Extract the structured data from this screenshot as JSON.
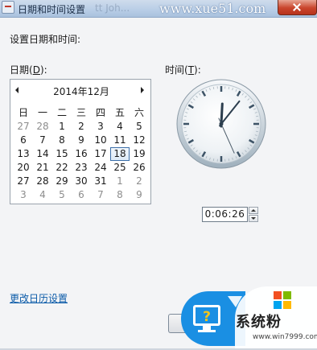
{
  "window": {
    "title": "日期和时间设置",
    "title_ghost": "tt Joh...",
    "watermark": "www.xue51.com"
  },
  "heading": "设置日期和时间:",
  "date_section": {
    "label_prefix": "日期(",
    "accel": "D",
    "label_suffix": "):"
  },
  "time_section": {
    "label_prefix": "时间(",
    "accel": "T",
    "label_suffix": "):"
  },
  "calendar": {
    "month_title": "2014年12月",
    "weekdays": [
      "日",
      "一",
      "二",
      "三",
      "四",
      "五",
      "六"
    ],
    "weeks": [
      [
        "27",
        "28",
        "1",
        "2",
        "3",
        "4",
        "5"
      ],
      [
        "6",
        "7",
        "8",
        "9",
        "10",
        "11",
        "12"
      ],
      [
        "13",
        "14",
        "15",
        "16",
        "17",
        "18",
        "19"
      ],
      [
        "20",
        "21",
        "22",
        "23",
        "24",
        "25",
        "26"
      ],
      [
        "27",
        "28",
        "29",
        "30",
        "31",
        "1",
        "2"
      ],
      [
        "3",
        "4",
        "5",
        "6",
        "7",
        "8",
        "9"
      ]
    ],
    "selected_day": "18"
  },
  "clock": {
    "hours": 0,
    "minutes": 6,
    "seconds": 26
  },
  "time_value": "0:06:26",
  "change_calendar_link": "更改日历设置",
  "logo": {
    "text": "系统粉",
    "url": "www.win7999.com"
  },
  "colors": {
    "link": "#0a5aa8",
    "accent_blue": "#1a8fe3",
    "titlebar": "#b8cde6"
  }
}
